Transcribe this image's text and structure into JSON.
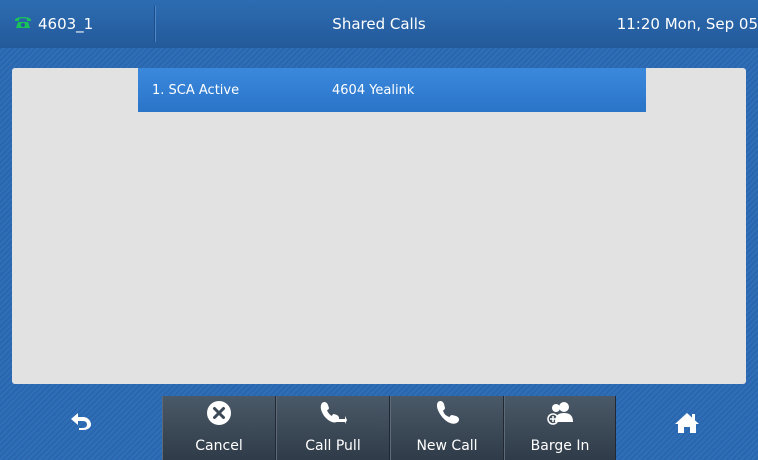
{
  "status_bar": {
    "account": "4603_1",
    "title": "Shared Calls",
    "clock": "11:20 Mon, Sep 05"
  },
  "list": {
    "rows": [
      {
        "index_label": "1. SCA Active",
        "value": "4604 Yealink"
      }
    ]
  },
  "softkeys": {
    "back_icon": "back-arrow-icon",
    "cancel": "Cancel",
    "call_pull": "Call Pull",
    "new_call": "New Call",
    "barge_in": "Barge In",
    "home_icon": "home-icon"
  },
  "colors": {
    "background": "#2f6fb8",
    "selected_row": "#2f7ad0",
    "softkey": "#3b4856",
    "panel": "#e2e2e2",
    "phone_icon": "#19c35a"
  }
}
